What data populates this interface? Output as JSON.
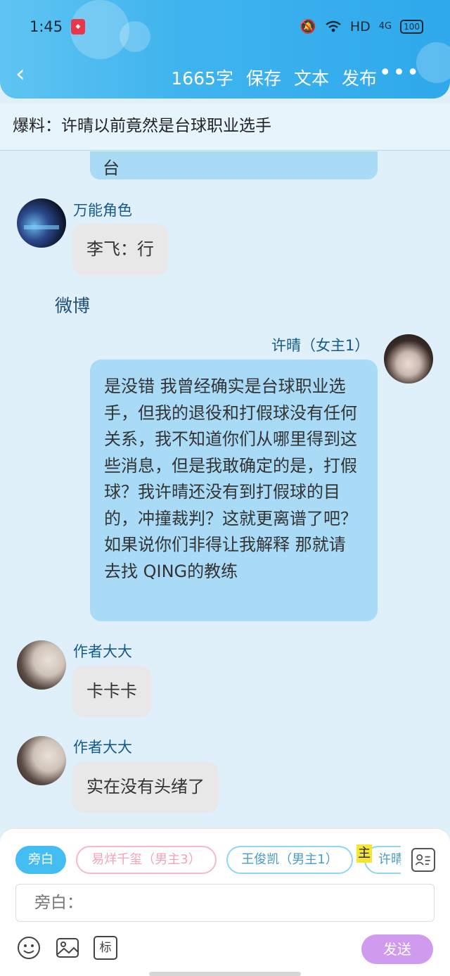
{
  "status_bar": {
    "time": "1:45",
    "network": "HD",
    "signal": "4G",
    "battery": "100"
  },
  "header": {
    "word_count": "1665字",
    "save_label": "保存",
    "text_label": "文本",
    "publish_label": "发布",
    "more_label": "•••",
    "back_label": "‹"
  },
  "title": "爆料：许晴以前竟然是台球职业选手",
  "chat": {
    "partial_tail": "台",
    "messages": [
      {
        "name": "万能角色",
        "text": "李飞：行"
      },
      {
        "narration": "微博"
      },
      {
        "name": "许晴（女主1）",
        "text": "是没错 我曾经确实是台球职业选手，但我的退役和打假球没有任何关系，我不知道你们从哪里得到这些消息，但是我敢确定的是，打假球？我许晴还没有到打假球的目的，冲撞裁判？这就更离谱了吧？如果说你们非得让我解释 那就请去找 QING的教练"
      },
      {
        "name": "作者大大",
        "text": "卡卡卡"
      },
      {
        "name": "作者大大",
        "text": "实在没有头绪了"
      }
    ]
  },
  "input_panel": {
    "roles": [
      "旁白",
      "易烊千玺（男主3）",
      "王俊凯（男主1）",
      "许晴"
    ],
    "active_role": "旁白",
    "role_marker": "主",
    "input_placeholder": "旁白：",
    "send_label": "发送",
    "tag_label": "标"
  }
}
